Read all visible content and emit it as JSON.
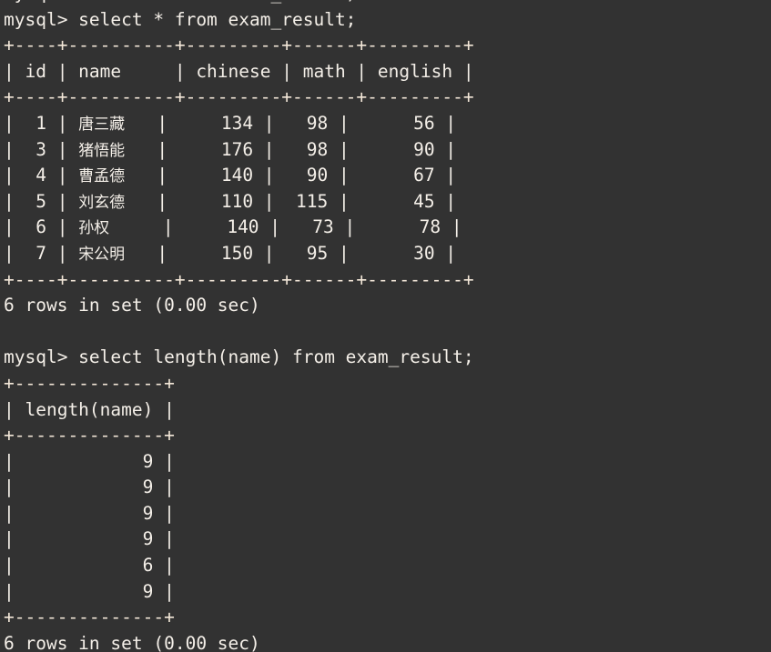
{
  "terminal": {
    "background_color": "#323232",
    "foreground_color": "#f4efe8",
    "border_color": "#f3e7d8",
    "clipped_top_line": "mysql> select * from exam_result;",
    "blocks": [
      {
        "name": "select-all-block",
        "prompt": "mysql> select * from exam_result;",
        "rule_top": "+----+----------+---------+------+---------+",
        "header": "| id | name     | chinese | math | english |",
        "rule_mid": "+----+----------+---------+------+---------+",
        "rows": [
          "|  1 | 唐三藏   |     134 |   98 |      56 |",
          "|  3 | 猪悟能   |     176 |   98 |      90 |",
          "|  4 | 曹孟德   |     140 |   90 |      67 |",
          "|  5 | 刘玄德   |     110 |  115 |      45 |",
          "|  6 | 孙权     |     140 |   73 |      78 |",
          "|  7 | 宋公明   |     150 |   95 |      30 |"
        ],
        "rule_bottom": "+----+----------+---------+------+---------+",
        "status": "6 rows in set (0.00 sec)"
      },
      {
        "name": "select-length-block",
        "prompt": "mysql> select length(name) from exam_result;",
        "rule_top": "+--------------+",
        "header": "| length(name) |",
        "rule_mid": "+--------------+",
        "rows": [
          "|            9 |",
          "|            9 |",
          "|            9 |",
          "|            9 |",
          "|            6 |",
          "|            9 |"
        ],
        "rule_bottom": "+--------------+",
        "status": "6 rows in set (0.00 sec)"
      }
    ],
    "blank_line": " "
  },
  "table_data": {
    "table_name": "exam_result",
    "columns": [
      "id",
      "name",
      "chinese",
      "math",
      "english"
    ],
    "rows": [
      {
        "id": 1,
        "name": "唐三藏",
        "chinese": 134,
        "math": 98,
        "english": 56
      },
      {
        "id": 3,
        "name": "猪悟能",
        "chinese": 176,
        "math": 98,
        "english": 90
      },
      {
        "id": 4,
        "name": "曹孟德",
        "chinese": 140,
        "math": 90,
        "english": 67
      },
      {
        "id": 5,
        "name": "刘玄德",
        "chinese": 110,
        "math": 115,
        "english": 45
      },
      {
        "id": 6,
        "name": "孙权",
        "chinese": 140,
        "math": 73,
        "english": 78
      },
      {
        "id": 7,
        "name": "宋公明",
        "chinese": 150,
        "math": 95,
        "english": 30
      }
    ],
    "length_name_values": [
      9,
      9,
      9,
      9,
      6,
      9
    ],
    "row_count": 6,
    "elapsed": "0.00 sec"
  }
}
